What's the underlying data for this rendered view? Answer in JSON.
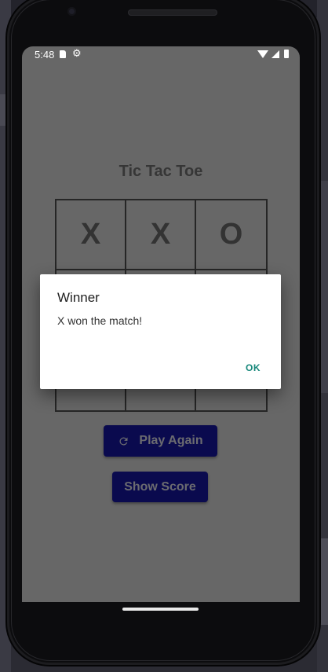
{
  "status_bar": {
    "time": "5:48",
    "icons": [
      "sd-card-icon",
      "settings-gear-icon",
      "wifi-icon",
      "cell-signal-icon",
      "battery-icon"
    ]
  },
  "game": {
    "title": "Tic Tac Toe",
    "board": [
      "X",
      "X",
      "O",
      "",
      "",
      "",
      "",
      "",
      ""
    ]
  },
  "buttons": {
    "play_again": "Play Again",
    "show_score": "Show Score"
  },
  "dialog": {
    "title": "Winner",
    "message": "X won the match!",
    "ok_label": "OK"
  },
  "colors": {
    "screen_dimmed": "#676767",
    "button_bg": "#0a0a4e",
    "dialog_action": "#16877a"
  }
}
